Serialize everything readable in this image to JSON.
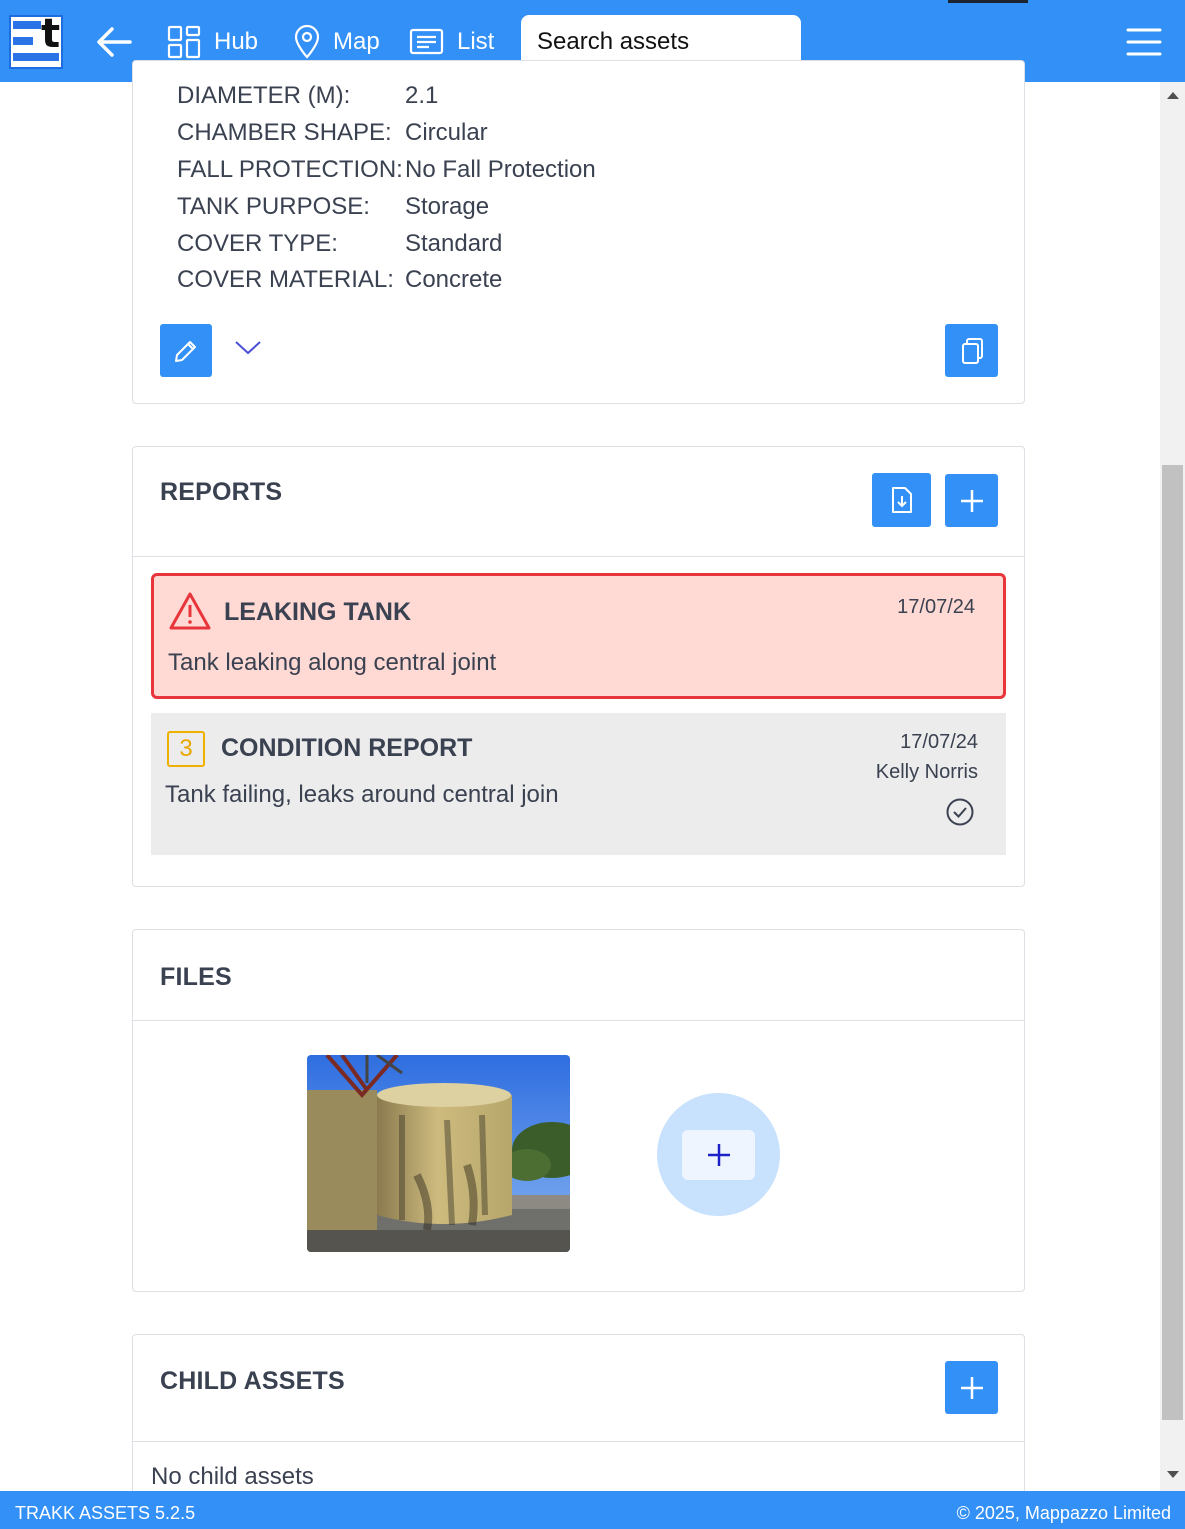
{
  "header": {
    "logo_letter": "t",
    "nav": [
      {
        "label": "Hub",
        "icon": "grid-icon"
      },
      {
        "label": "Map",
        "icon": "map-pin-icon"
      },
      {
        "label": "List",
        "icon": "list-icon"
      }
    ],
    "search_placeholder": "Search assets"
  },
  "properties": [
    {
      "key": "DIAMETER (M):",
      "value": "2.1"
    },
    {
      "key": "CHAMBER SHAPE:",
      "value": "Circular"
    },
    {
      "key": "FALL PROTECTION:",
      "value": "No Fall Protection"
    },
    {
      "key": "TANK PURPOSE:",
      "value": "Storage"
    },
    {
      "key": "COVER TYPE:",
      "value": "Standard"
    },
    {
      "key": "COVER MATERIAL:",
      "value": "Concrete"
    }
  ],
  "reports": {
    "title": "REPORTS",
    "alert": {
      "title": "LEAKING TANK",
      "date": "17/07/24",
      "description": "Tank leaking along central joint"
    },
    "condition": {
      "score": "3",
      "title": "CONDITION REPORT",
      "date": "17/07/24",
      "author": "Kelly Norris",
      "description": "Tank failing, leaks around central join"
    }
  },
  "files": {
    "title": "FILES"
  },
  "child_assets": {
    "title": "CHILD ASSETS",
    "empty_text": "No child assets"
  },
  "footer": {
    "version": "TRAKK ASSETS 5.2.5",
    "copyright": "© 2025, Mappazzo Limited"
  },
  "colors": {
    "primary": "#3390f7",
    "alert_bg": "#ffd9d3",
    "alert_border": "#e8353b",
    "condition_badge": "#f0b000"
  }
}
